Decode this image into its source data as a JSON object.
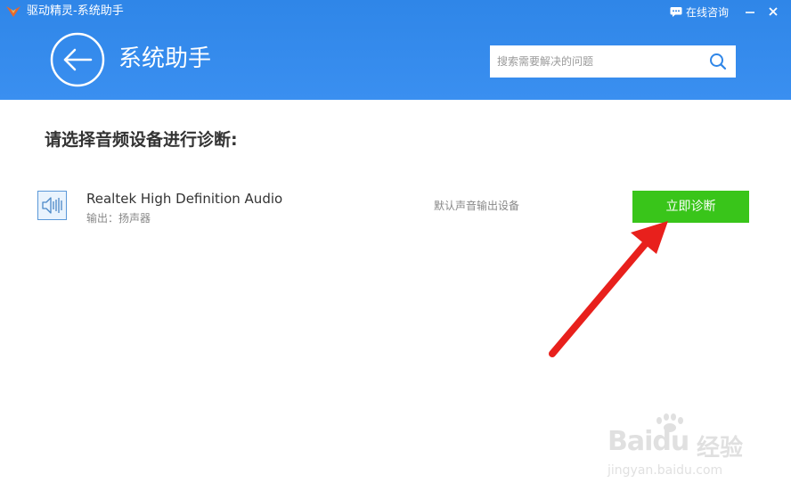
{
  "titlebar": {
    "app_title": "驱动精灵-系统助手",
    "online_consult": "在线咨询"
  },
  "header": {
    "page_title": "系统助手",
    "search_placeholder": "搜索需要解决的问题"
  },
  "main": {
    "heading": "请选择音频设备进行诊断:",
    "devices": [
      {
        "name": "Realtek High Definition Audio",
        "subtitle": "输出：扬声器",
        "status": "默认声音输出设备",
        "action_label": "立即诊断"
      }
    ]
  },
  "watermark": {
    "brand": "Baidu",
    "brand_cn": "经验",
    "url": "jingyan.baidu.com"
  },
  "colors": {
    "header_blue": "#3a8ff0",
    "action_green": "#39c51a",
    "annotation_red": "#e8201c"
  }
}
